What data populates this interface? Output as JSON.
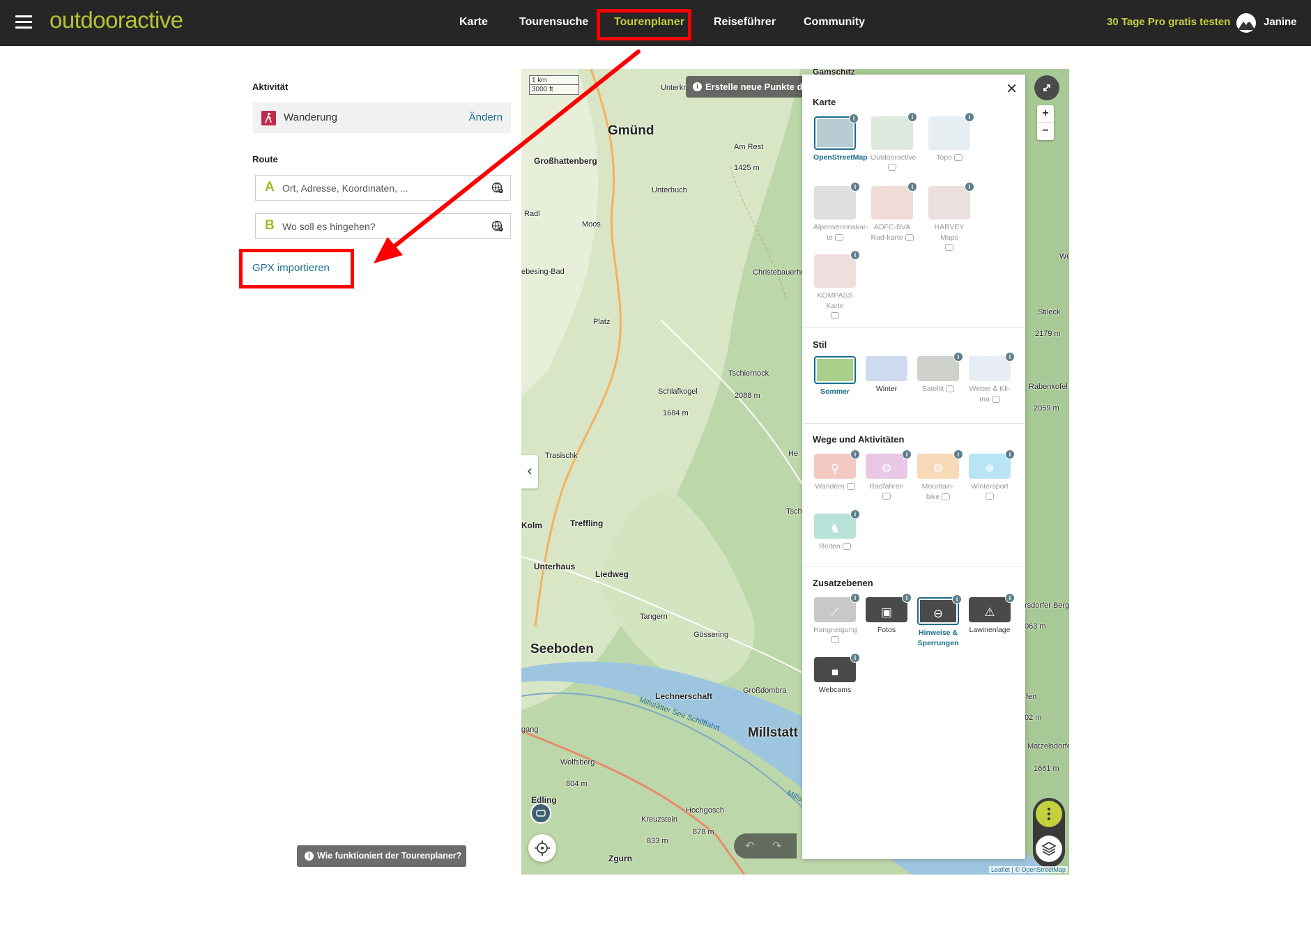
{
  "header": {
    "logo": "outdooractive",
    "nav": [
      "Karte",
      "Tourensuche",
      "Tourenplaner",
      "Reiseführer",
      "Community"
    ],
    "trial_cta": "30 Tage Pro gratis testen",
    "user_name": "Janine",
    "accent_color": "#c4d13f"
  },
  "planner": {
    "activity_label": "Aktivität",
    "activity_value": "Wanderung",
    "activity_change": "Ändern",
    "route_label": "Route",
    "start_letter": "A",
    "start_placeholder": "Ort, Adresse, Koordinaten, ...",
    "end_letter": "B",
    "end_placeholder": "Wo soll es hingehen?",
    "gpx_import": "GPX importieren",
    "help_button": "Wie funktioniert der Tourenplaner?"
  },
  "map": {
    "scale_km": "1 km",
    "scale_ft": "3000 ft",
    "hint": "Erstelle neue Punkte du",
    "attribution": "Leaflet | © OpenStreetMap",
    "zoom_in": "+",
    "zoom_out": "−",
    "labels": {
      "gamschitz": "Gamschitz",
      "unterkr": "Unterkr",
      "gmuend": "Gmünd",
      "am_rest": "Am Rest",
      "am_rest_ele": "1425 m",
      "grosshattenberg": "Großhattenberg",
      "unterbuch": "Unterbuch",
      "radl": "Radl",
      "moos": "Moos",
      "ebesing_bad": "ebesing-Bad",
      "christebauer": "Christebauerhütt",
      "platz": "Platz",
      "tschiernock": "Tschiernock",
      "tschiernock_ele": "2088 m",
      "schlafkogel": "Schlafkogel",
      "schlafkogel_ele": "1684 m",
      "trasischk": "Trasischk",
      "kolm": "Kolm",
      "treffling": "Treffling",
      "unterhaus": "Unterhaus",
      "liedweg": "Liedweg",
      "tangern": "Tangern",
      "gossering": "Gössering",
      "seeboden": "Seeboden",
      "lechnerschaft": "Lechnerschaft",
      "grossdombra": "Großdombra",
      "lake_route": "Millstätter See Schifffahrt",
      "millstatt": "Millstatt",
      "gang": "gang",
      "wolfsberg": "Wolfsberg",
      "wolfsberg_ele": "804 m",
      "edling": "Edling",
      "hochgosch": "Hochgosch",
      "hochgosch_ele": "878 m",
      "kreuzstein": "Kreuzstein",
      "kreuzstein_ele": "833 m",
      "zgurn": "Zgurn",
      "stileck": "Stileck",
      "stileck_ele": "2179 m",
      "rabenkofel": "Rabenkofel",
      "rabenkofel_ele": "2059 m",
      "we": "We",
      "tsch": "Tsch",
      "he": "He",
      "rsdorfer": "rsdorfer Berg",
      "rsdorfer_ele": "063 m",
      "fen": "fen",
      "fen_ele": "02 m",
      "matzelsdorfer": "Matzelsdorfer",
      "matzelsdorfer_ele": "1661 m",
      "millstatt_lake2": "Millstät"
    }
  },
  "layer_panel": {
    "karte_title": "Karte",
    "karte": [
      "OpenStreetMap",
      "Outdooractive",
      "Topo",
      "Alpenvereinskar-te",
      "ADFC-BVA Rad-karte",
      "HARVEY Maps",
      "KOMPASS Karte"
    ],
    "stil_title": "Stil",
    "stil": [
      "Sommer",
      "Winter",
      "Satellit",
      "Wetter & Kli-ma"
    ],
    "wege_title": "Wege und Aktivitäten",
    "wege": [
      "Wandern",
      "Radfahren",
      "Mountain-bike",
      "Wintersport",
      "Reiten"
    ],
    "zusatz_title": "Zusatzebenen",
    "zusatz": [
      "Hangneigung",
      "Fotos",
      "Hinweise & Sperrungen",
      "Lawinenlage",
      "Webcams"
    ],
    "close": "✕",
    "info_glyph": "i"
  },
  "colors": {
    "link": "#1a6e8d",
    "annotation": "#ff0000",
    "activity_icon": "#c0294a"
  }
}
